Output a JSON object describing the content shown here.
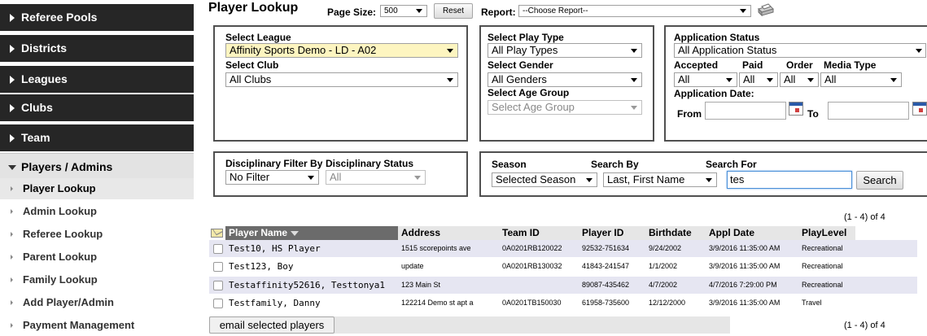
{
  "sidebar": {
    "items": [
      {
        "label": "Referee Pools"
      },
      {
        "label": "Districts"
      },
      {
        "label": "Leagues"
      },
      {
        "label": "Clubs"
      },
      {
        "label": "Team"
      }
    ],
    "open_section": {
      "label": "Players / Admins"
    },
    "sub_items": [
      {
        "label": "Player Lookup",
        "active": true
      },
      {
        "label": "Admin Lookup"
      },
      {
        "label": "Referee Lookup"
      },
      {
        "label": "Parent Lookup"
      },
      {
        "label": "Family Lookup"
      },
      {
        "label": "Add Player/Admin"
      },
      {
        "label": "Payment Management"
      }
    ]
  },
  "header": {
    "title": "Player Lookup",
    "page_size_label": "Page Size:",
    "page_size_value": "500",
    "reset_label": "Reset",
    "report_label": "Report:",
    "report_value": "--Choose Report--"
  },
  "filters": {
    "league_label": "Select League",
    "league_value": "Affinity Sports Demo - LD - A02",
    "club_label": "Select Club",
    "club_value": "All Clubs",
    "play_type_label": "Select Play Type",
    "play_type_value": "All Play Types",
    "gender_label": "Select Gender",
    "gender_value": "All Genders",
    "age_group_label": "Select Age Group",
    "age_group_value": "Select Age Group",
    "app_status_label": "Application Status",
    "app_status_value": "All Application Status",
    "accepted_label": "Accepted",
    "accepted_value": "All",
    "paid_label": "Paid",
    "paid_value": "All",
    "order_label": "Order",
    "order_value": "All",
    "media_type_label": "Media Type",
    "media_type_value": "All",
    "app_date_label": "Application Date:",
    "from_label": "From",
    "to_label": "To",
    "disc_filter_label": "Disciplinary Filter By",
    "disc_filter_value": "No Filter",
    "disc_status_label": "Disciplinary Status",
    "disc_status_value": "All",
    "season_label": "Season",
    "season_value": "Selected Season",
    "search_by_label": "Search By",
    "search_by_value": "Last, First Name",
    "search_for_label": "Search For",
    "search_for_value": "tes",
    "search_button": "Search"
  },
  "results": {
    "count_top": "(1 - 4) of 4",
    "count_bottom": "(1 - 4) of 4",
    "columns": [
      "Player Name",
      "Address",
      "Team ID",
      "Player ID",
      "Birthdate",
      "Appl Date",
      "PlayLevel"
    ],
    "rows": [
      [
        "Test10, HS Player",
        "1515 scorepoints ave",
        "0A0201RB120022",
        "92532-751634",
        "9/24/2002",
        "3/9/2016 11:35:00 AM",
        "Recreational"
      ],
      [
        "Test123, Boy",
        "update",
        "0A0201RB130032",
        "41843-241547",
        "1/1/2002",
        "3/9/2016 11:35:00 AM",
        "Recreational"
      ],
      [
        "Testaffinity52616, Testtonya1",
        "123 Main St",
        "",
        "89087-435462",
        "4/7/2002",
        "4/7/2016 7:29:00 PM",
        "Recreational"
      ],
      [
        "Testfamily, Danny",
        "122214 Demo st apt a",
        "0A0201TB150030",
        "61958-735600",
        "12/12/2000",
        "3/9/2016 11:35:00 AM",
        "Travel"
      ]
    ],
    "email_button": "email selected players"
  }
}
